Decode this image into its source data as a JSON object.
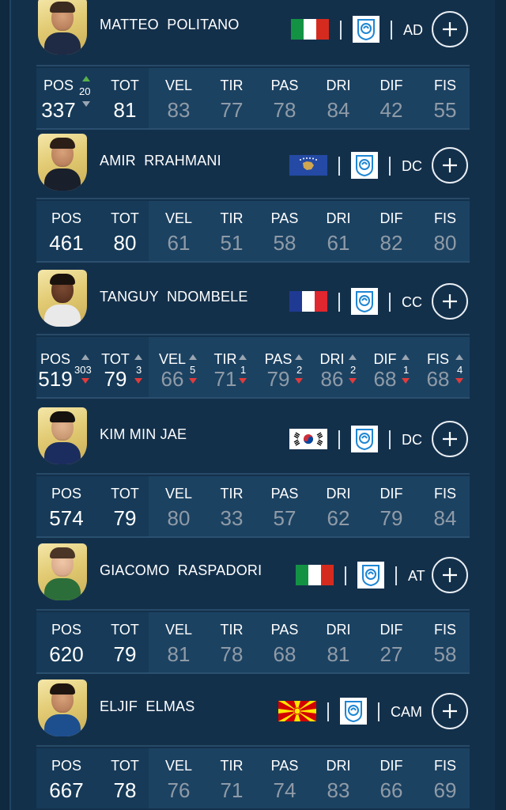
{
  "colors": {
    "background": "#13304b",
    "stats_left_bg": "#163a58",
    "stats_right_bg": "#1c4262",
    "dim_value": "#8f9ba7",
    "arrow_up_active": "#5ab04b",
    "arrow_down_active": "#e23b3b",
    "card_gold": "#e2cb74"
  },
  "labels": {
    "pos": "POS",
    "tot": "TOT",
    "vel": "VEL",
    "tir": "TIR",
    "pas": "PAS",
    "dri": "DRI",
    "dif": "DIF",
    "fis": "FIS"
  },
  "players": [
    {
      "name": "MATTEO  POLITANO",
      "flag": "italy-flag",
      "club_icon": "club-crest-icon",
      "position": "AD",
      "pos": "337",
      "tot": "81",
      "vel": "83",
      "tir": "77",
      "pas": "78",
      "dri": "84",
      "dif": "42",
      "fis": "55",
      "pos_delta": "20"
    },
    {
      "name": "AMIR  RRAHMANI",
      "flag": "kosovo-flag",
      "club_icon": "club-crest-icon",
      "position": "DC",
      "pos": "461",
      "tot": "80",
      "vel": "61",
      "tir": "51",
      "pas": "58",
      "dri": "61",
      "dif": "82",
      "fis": "80"
    },
    {
      "name": "TANGUY  NDOMBELE",
      "flag": "france-flag",
      "club_icon": "club-crest-icon",
      "position": "CC",
      "pos": "519",
      "tot": "79",
      "vel": "66",
      "tir": "71",
      "pas": "79",
      "dri": "86",
      "dif": "68",
      "fis": "68",
      "deltas": {
        "pos": "303",
        "tot": "3",
        "vel": "5",
        "tir": "1",
        "pas": "2",
        "dri": "2",
        "dif": "1",
        "fis": "4"
      }
    },
    {
      "name": "KIM MIN JAE",
      "flag": "south-korea-flag",
      "club_icon": "club-crest-icon",
      "position": "DC",
      "pos": "574",
      "tot": "79",
      "vel": "80",
      "tir": "33",
      "pas": "57",
      "dri": "62",
      "dif": "79",
      "fis": "84"
    },
    {
      "name": "GIACOMO  RASPADORI",
      "flag": "italy-flag",
      "club_icon": "club-crest-icon",
      "position": "AT",
      "pos": "620",
      "tot": "79",
      "vel": "81",
      "tir": "78",
      "pas": "68",
      "dri": "81",
      "dif": "27",
      "fis": "58"
    },
    {
      "name": "ELJIF  ELMAS",
      "flag": "north-macedonia-flag",
      "club_icon": "club-crest-icon",
      "position": "CAM",
      "pos": "667",
      "tot": "78",
      "vel": "76",
      "tir": "71",
      "pas": "74",
      "dri": "83",
      "dif": "66",
      "fis": "69"
    }
  ]
}
